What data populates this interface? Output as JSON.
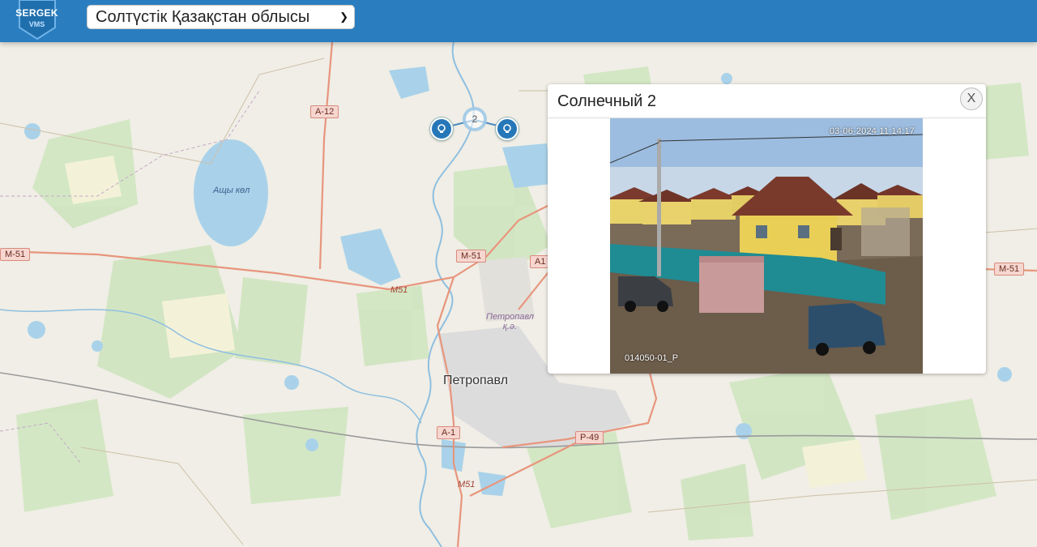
{
  "header": {
    "logo_text": "SERGEK",
    "logo_sub": "VMS",
    "region_selected": "Солтүстік Қазақстан облысы",
    "brand_color": "#2a7ebf"
  },
  "map": {
    "city_name": "Петропавл",
    "city_district": "Петропавл\nқ.ә.",
    "lake_name": "Ащы көл",
    "road_shields": [
      "А-12",
      "М-51",
      "М-51",
      "A1",
      "М-51",
      "А-1",
      "Р-49"
    ],
    "road_numbers": [
      "М51",
      "М51"
    ],
    "cluster_count": "2",
    "markers": [
      {
        "name": "camera-marker",
        "icon": "camera-icon"
      },
      {
        "name": "camera-marker",
        "icon": "camera-icon"
      }
    ]
  },
  "popup": {
    "title": "Солнечный 2",
    "close_label": "X",
    "feed_timestamp": "03-06-2024 11:14:17",
    "feed_camera_id": "014050-01_P"
  }
}
